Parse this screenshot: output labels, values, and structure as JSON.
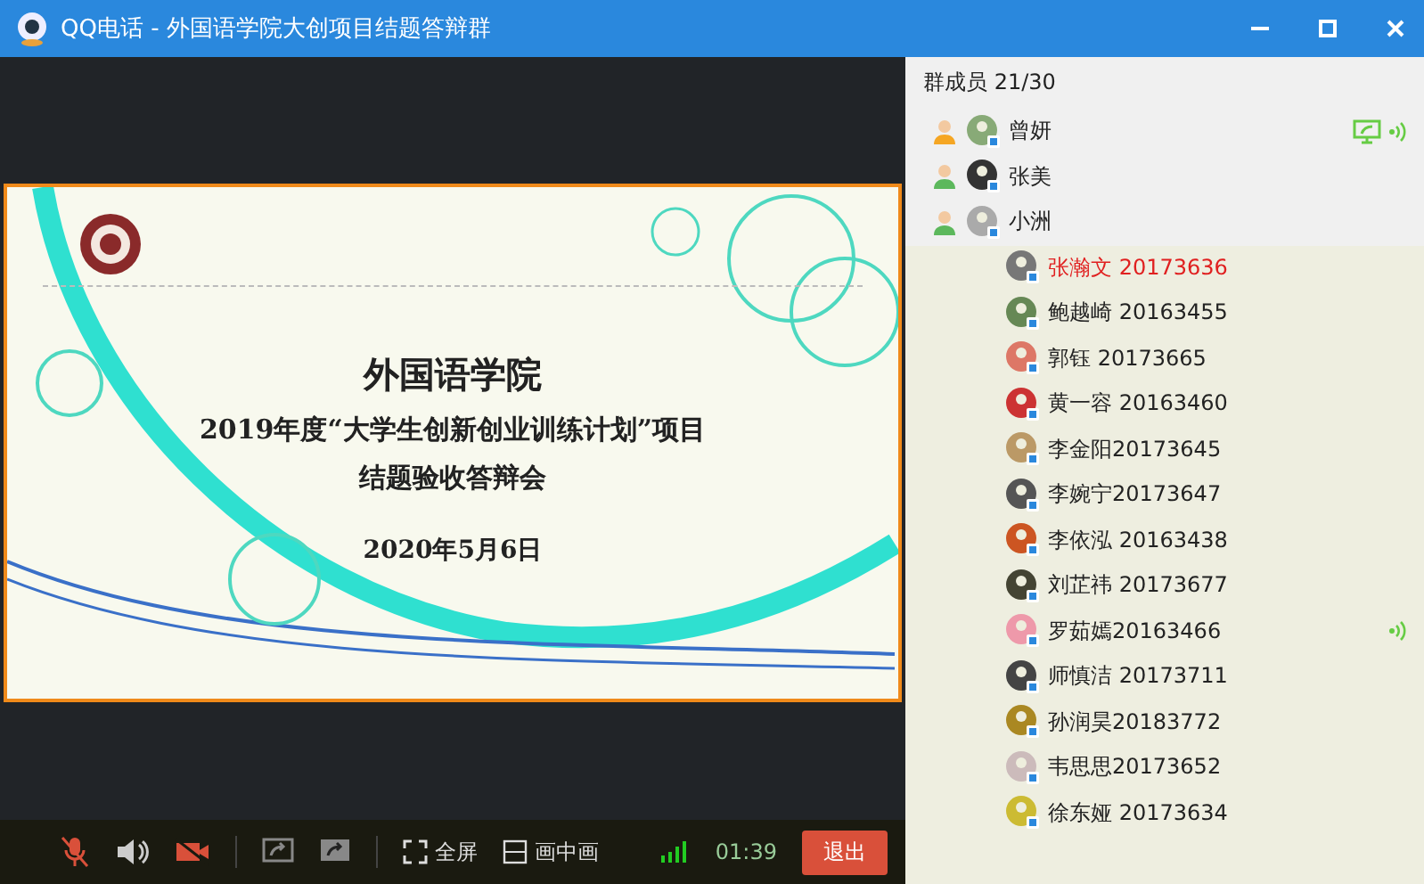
{
  "window": {
    "title": "QQ电话 - 外国语学院大创项目结题答辩群"
  },
  "slide": {
    "lines": [
      "外国语学院",
      "2019年度“大学生创新创业训练计划”项目",
      "结题验收答辩会",
      "2020年5月6日"
    ]
  },
  "toolbar": {
    "mic_muted": true,
    "camera_off": true,
    "fullscreen_label": "全屏",
    "pip_label": "画中画",
    "duration": "01:39",
    "exit_label": "退出"
  },
  "members": {
    "header": "群成员 21/30",
    "items": [
      {
        "name": "曾妍",
        "kind": "owner",
        "highlighted": false,
        "speaking": true,
        "sharing_screen": true
      },
      {
        "name": "张美",
        "kind": "admin",
        "highlighted": false,
        "speaking": false,
        "sharing_screen": false
      },
      {
        "name": "小洲",
        "kind": "admin",
        "highlighted": false,
        "speaking": false,
        "sharing_screen": false
      },
      {
        "name": "张瀚文 20173636",
        "kind": "member",
        "highlighted": true,
        "speaking": false,
        "sharing_screen": false
      },
      {
        "name": "鲍越崎 20163455",
        "kind": "member",
        "highlighted": false,
        "speaking": false,
        "sharing_screen": false
      },
      {
        "name": "郭钰 20173665",
        "kind": "member",
        "highlighted": false,
        "speaking": false,
        "sharing_screen": false
      },
      {
        "name": "黄一容 20163460",
        "kind": "member",
        "highlighted": false,
        "speaking": false,
        "sharing_screen": false
      },
      {
        "name": "李金阳20173645",
        "kind": "member",
        "highlighted": false,
        "speaking": false,
        "sharing_screen": false
      },
      {
        "name": "李婉宁20173647",
        "kind": "member",
        "highlighted": false,
        "speaking": false,
        "sharing_screen": false
      },
      {
        "name": "李依泓 20163438",
        "kind": "member",
        "highlighted": false,
        "speaking": false,
        "sharing_screen": false
      },
      {
        "name": "刘芷祎 20173677",
        "kind": "member",
        "highlighted": false,
        "speaking": false,
        "sharing_screen": false
      },
      {
        "name": "罗茹嫣20163466",
        "kind": "member",
        "highlighted": false,
        "speaking": true,
        "sharing_screen": false
      },
      {
        "name": "师慎洁 20173711",
        "kind": "member",
        "highlighted": false,
        "speaking": false,
        "sharing_screen": false
      },
      {
        "name": "孙润昊20183772",
        "kind": "member",
        "highlighted": false,
        "speaking": false,
        "sharing_screen": false
      },
      {
        "name": "韦思思20173652",
        "kind": "member",
        "highlighted": false,
        "speaking": false,
        "sharing_screen": false
      },
      {
        "name": "徐东娅 20173634",
        "kind": "member",
        "highlighted": false,
        "speaking": false,
        "sharing_screen": false
      }
    ]
  }
}
